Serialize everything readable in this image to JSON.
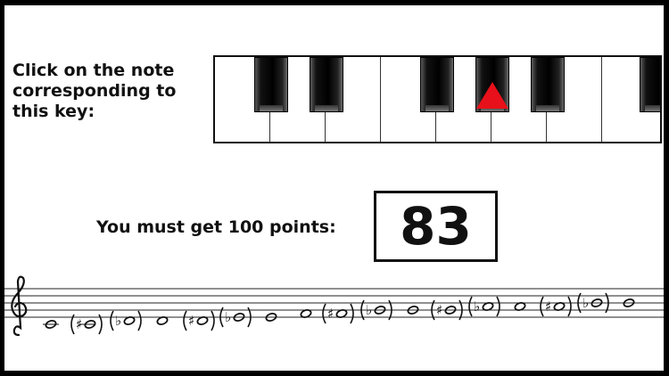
{
  "instruction": "Click on the note\ncorresponding to\nthis key:",
  "goal_label": "You must get 100 points:",
  "score": "83",
  "marker_color": "#e8101a",
  "piano": {
    "white_key_count": 8,
    "black_keys": [
      "C#",
      "D#",
      "F#",
      "G#",
      "A#",
      "C#"
    ],
    "highlighted_key": "G#"
  },
  "staff": {
    "clef": "treble-clef-icon",
    "notes": [
      {
        "label": "C",
        "accidental": ""
      },
      {
        "label": "C#",
        "accidental": "♯"
      },
      {
        "label": "Db",
        "accidental": "♭"
      },
      {
        "label": "D",
        "accidental": ""
      },
      {
        "label": "D#",
        "accidental": "♯"
      },
      {
        "label": "Eb",
        "accidental": "♭"
      },
      {
        "label": "E",
        "accidental": ""
      },
      {
        "label": "F",
        "accidental": ""
      },
      {
        "label": "F#",
        "accidental": "♯"
      },
      {
        "label": "Gb",
        "accidental": "♭"
      },
      {
        "label": "G",
        "accidental": ""
      },
      {
        "label": "G#",
        "accidental": "♯"
      },
      {
        "label": "Ab",
        "accidental": "♭"
      },
      {
        "label": "A",
        "accidental": ""
      },
      {
        "label": "A#",
        "accidental": "♯"
      },
      {
        "label": "Bb",
        "accidental": "♭"
      },
      {
        "label": "B",
        "accidental": ""
      }
    ]
  }
}
